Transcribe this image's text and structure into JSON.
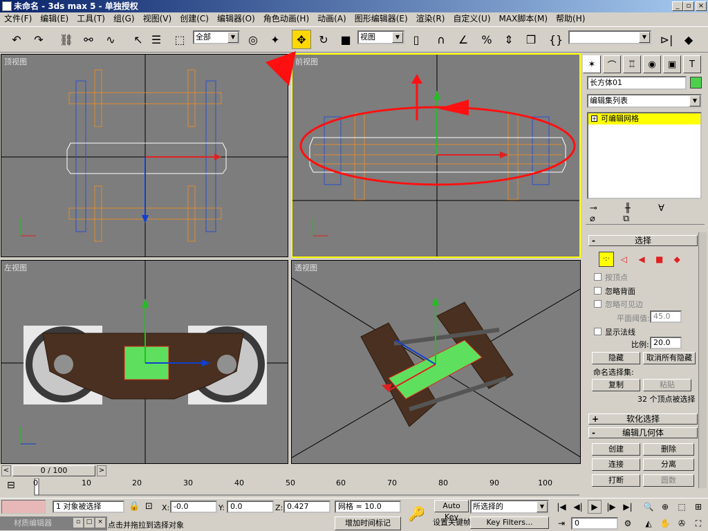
{
  "window": {
    "title": "未命名 - 3ds max 5 - 单独授权",
    "min": "_",
    "max": "▫",
    "close": "×"
  },
  "menu": [
    "文件(F)",
    "编辑(E)",
    "工具(T)",
    "组(G)",
    "视图(V)",
    "创建(C)",
    "编辑器(O)",
    "角色动画(H)",
    "动画(A)",
    "图形编辑器(E)",
    "渲染(R)",
    "自定义(U)",
    "MAX脚本(M)",
    "帮助(H)"
  ],
  "toolbar": {
    "selection_filter": "全部",
    "ref_coord": "视图",
    "named_selection": ""
  },
  "viewports": [
    {
      "label": "顶视图",
      "active": false
    },
    {
      "label": "前视图",
      "active": true
    },
    {
      "label": "左视图",
      "active": false
    },
    {
      "label": "透视图",
      "active": false
    }
  ],
  "axis": {
    "x": "x",
    "y": "y",
    "z": "z"
  },
  "panel": {
    "object_name": "长方体01",
    "object_color": "#4ed04e",
    "modifier_list": "编辑集列表",
    "stack_item": "可编辑网格",
    "rollout_select": "选择",
    "by_vertex": "按顶点",
    "ignore_backface": "忽略背面",
    "ignore_visible_edges": "忽略可见边",
    "planar_thresh_label": "平面阈值:",
    "planar_thresh": "45.0",
    "show_normals": "显示法线",
    "scale_label": "比例:",
    "scale": "20.0",
    "hide": "隐藏",
    "unhide_all": "取消所有隐藏",
    "named_sel": "命名选择集:",
    "copy": "复制",
    "paste": "粘贴",
    "sel_status": "32 个顶点被选择",
    "rollout_soft": "软化选择",
    "rollout_edit_geo": "编辑几何体",
    "create": "创建",
    "delete": "删除",
    "attach": "连接",
    "detach": "分离",
    "break": "打断",
    "chamfer": "圆数"
  },
  "timeline": {
    "frame": "0 / 100",
    "ticks": [
      "0",
      "10",
      "20",
      "30",
      "40",
      "50",
      "60",
      "70",
      "80",
      "90",
      "100"
    ]
  },
  "status": {
    "selected": "1 对象被选择",
    "prompt": "点击并拖拉到选择对象",
    "x_label": "X:",
    "x": "-0.0",
    "y_label": "Y:",
    "y": "0.0",
    "z_label": "Z:",
    "z": "0.427",
    "grid": "网格 = 10.0",
    "add_time_tag": "增加时间标记",
    "auto_key": "Auto Key",
    "set_key": "设置关键帧",
    "key_filter_value": "所选择的",
    "key_filters": "Key Filters...",
    "current_frame": "0",
    "mat_editor": "材质编辑器"
  }
}
